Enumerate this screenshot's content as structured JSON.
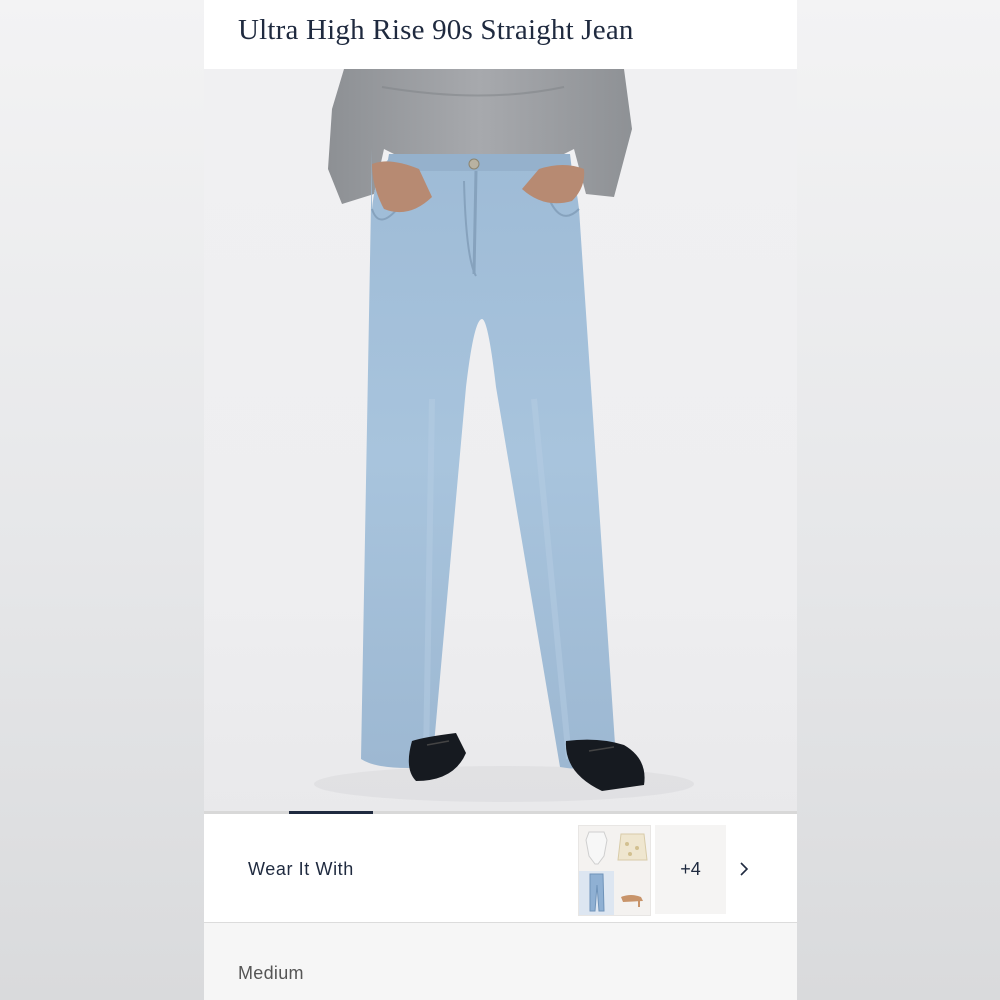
{
  "product": {
    "title": "Ultra High Rise 90s Straight Jean",
    "image_alt": "Model wearing light wash ultra high rise 90s straight jeans with grey sweater and black flats"
  },
  "gallery": {
    "active_index": 1,
    "total": 7
  },
  "wear_it_with": {
    "label": "Wear It With",
    "more_count": "+4",
    "items": [
      "bodysuit-icon",
      "cardigan-icon",
      "jeans-icon",
      "sandal-icon"
    ]
  },
  "variant": {
    "wash": "Medium"
  },
  "colors": {
    "text": "#1f2a3f",
    "denim": "#a9c3db",
    "sweater": "#9c9ea2"
  }
}
